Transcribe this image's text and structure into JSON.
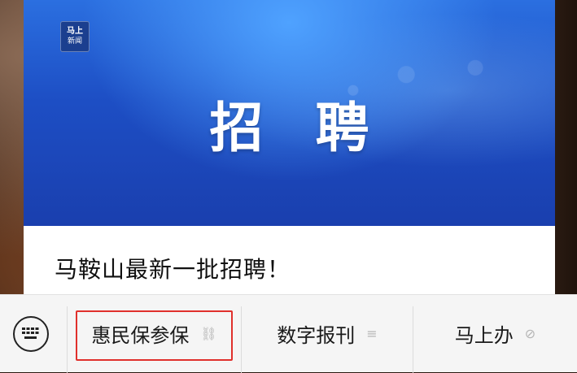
{
  "article": {
    "cover_logo_line1": "马上",
    "cover_logo_line2": "新闻",
    "cover_title": "招聘",
    "title": "马鞍山最新一批招聘！"
  },
  "menu": {
    "keyboard_icon": "keyboard-icon",
    "items": [
      {
        "label": "惠民保参保",
        "icon": "link-icon",
        "glyph": "⛓"
      },
      {
        "label": "数字报刊",
        "icon": "menu-lines-icon",
        "glyph": "≡"
      },
      {
        "label": "马上办",
        "icon": "mini-program-icon",
        "glyph": "⊘"
      }
    ]
  },
  "colors": {
    "cover_blue": "#1d4ec4",
    "highlight_red": "#e0302c",
    "menubar_bg": "#f5f5f5"
  }
}
